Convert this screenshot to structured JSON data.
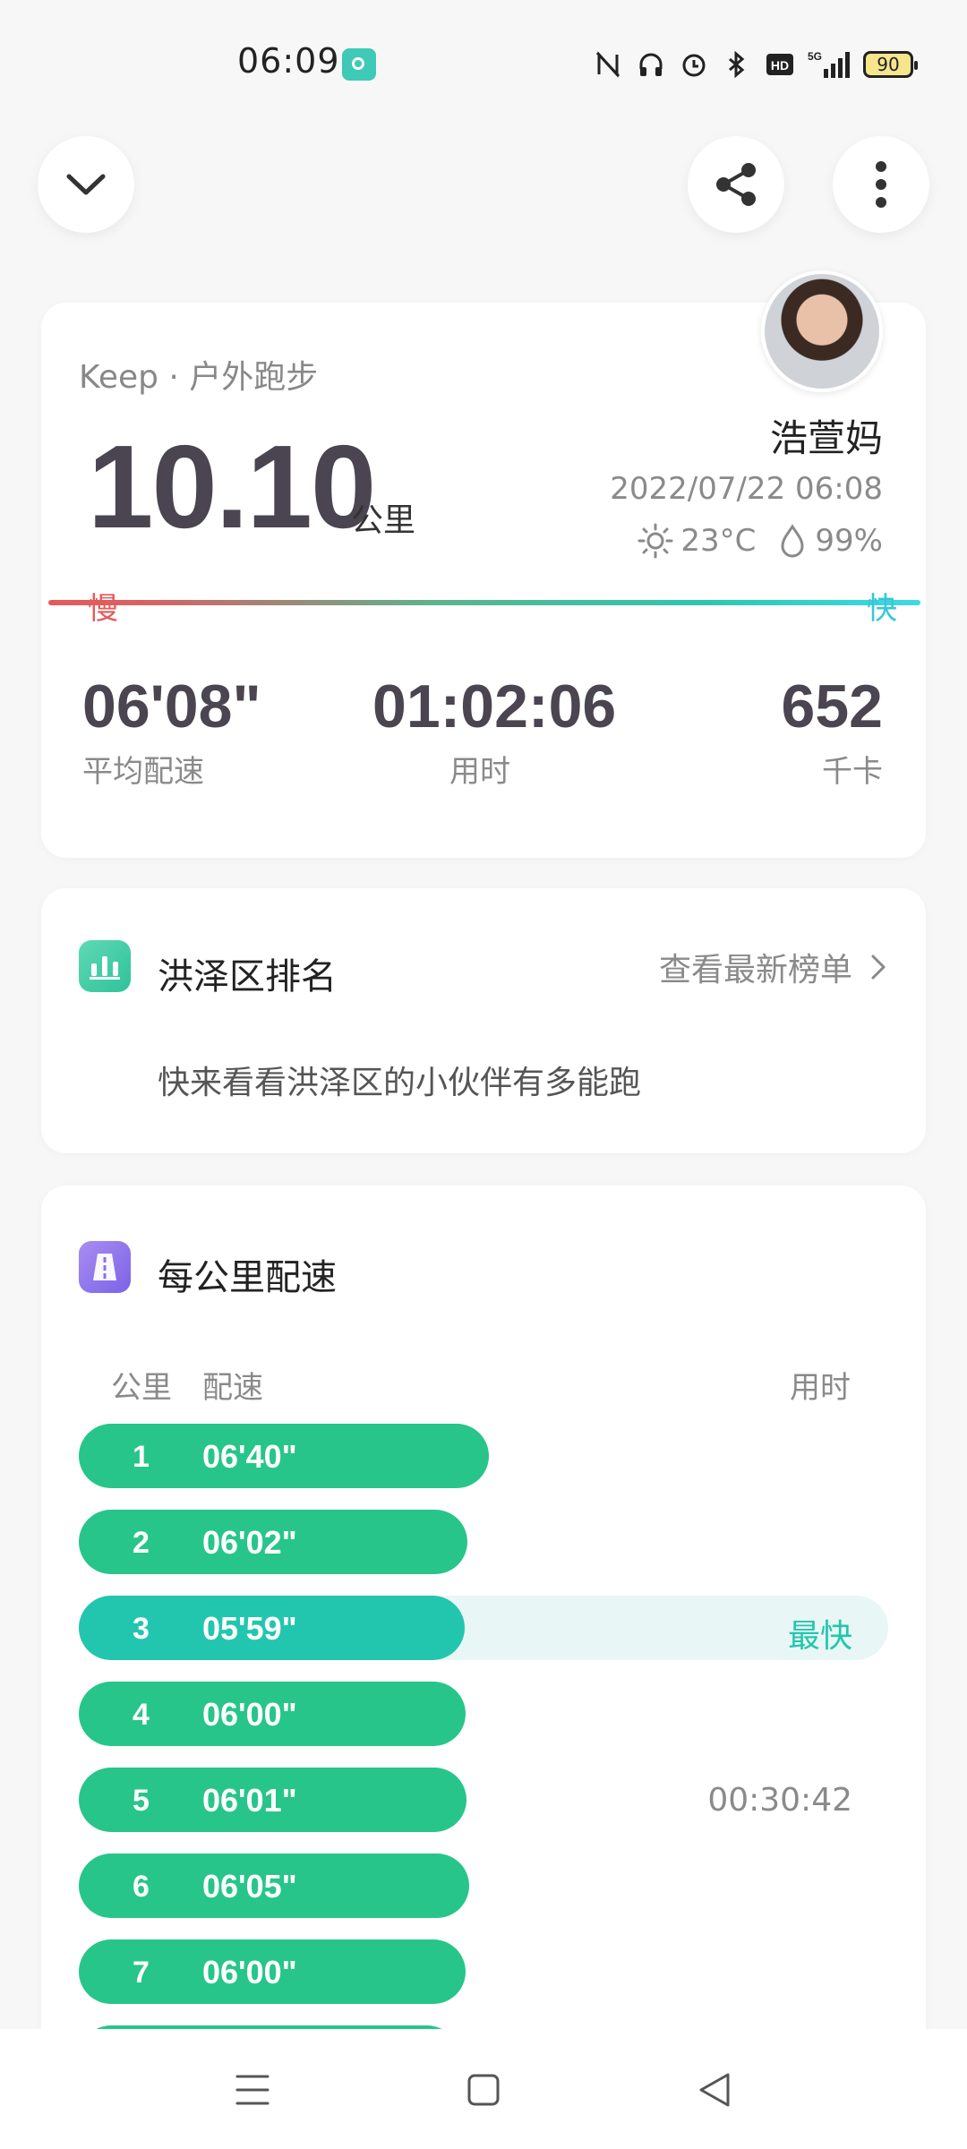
{
  "status_bar": {
    "time": "06:09",
    "battery": "90",
    "icons": [
      "nfc-icon",
      "headphones-icon",
      "alarm-icon",
      "bluetooth-icon",
      "hd-icon",
      "signal-5g-icon",
      "battery-icon"
    ]
  },
  "summary": {
    "source": "Keep · 户外跑步",
    "distance": "10.10",
    "distance_unit": "公里",
    "user_name": "浩萱妈",
    "datetime": "2022/07/22 06:08",
    "temperature": "23°C",
    "humidity": "99%",
    "slow_label": "慢",
    "fast_label": "快",
    "stats": [
      {
        "value": "06'08\"",
        "label": "平均配速"
      },
      {
        "value": "01:02:06",
        "label": "用时"
      },
      {
        "value": "652",
        "label": "千卡"
      }
    ]
  },
  "ranking": {
    "title": "洪泽区排名",
    "link": "查看最新榜单",
    "description": "快来看看洪泽区的小伙伴有多能跑"
  },
  "splits": {
    "title": "每公里配速",
    "col_km": "公里",
    "col_pace": "配速",
    "col_time": "用时",
    "rows": [
      {
        "km": "1",
        "pace": "06'40\"",
        "fraction": 0.507,
        "right": ""
      },
      {
        "km": "2",
        "pace": "06'02\"",
        "fraction": 0.48,
        "right": ""
      },
      {
        "km": "3",
        "pace": "05'59\"",
        "fraction": 0.477,
        "right": "最快",
        "best": true
      },
      {
        "km": "4",
        "pace": "06'00\"",
        "fraction": 0.478,
        "right": ""
      },
      {
        "km": "5",
        "pace": "06'01\"",
        "fraction": 0.479,
        "right": "00:30:42"
      },
      {
        "km": "6",
        "pace": "06'05\"",
        "fraction": 0.482,
        "right": ""
      },
      {
        "km": "7",
        "pace": "06'00\"",
        "fraction": 0.478,
        "right": ""
      },
      {
        "km": "",
        "pace": "",
        "fraction": 0.47,
        "right": ""
      }
    ]
  },
  "colors": {
    "accent_green": "#27c58a",
    "accent_teal": "#22c6ae",
    "slow_red": "#e55a5a",
    "fast_cyan": "#35c8d8"
  }
}
